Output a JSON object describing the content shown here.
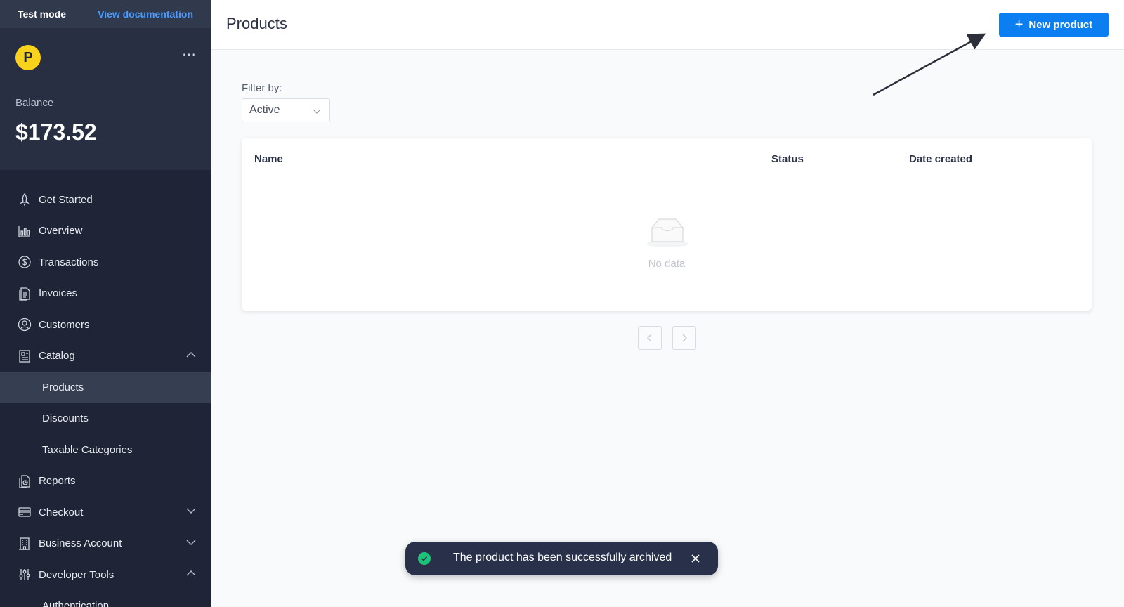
{
  "topbar": {
    "mode_label": "Test mode",
    "docs_link": "View documentation"
  },
  "account": {
    "logo_letter": "P",
    "more": "⋯",
    "balance_label": "Balance",
    "balance_value": "$173.52"
  },
  "sidebar": {
    "items": [
      {
        "label": "Get Started",
        "icon": "rocket-icon"
      },
      {
        "label": "Overview",
        "icon": "chart-icon"
      },
      {
        "label": "Transactions",
        "icon": "dollar-icon"
      },
      {
        "label": "Invoices",
        "icon": "invoice-icon"
      },
      {
        "label": "Customers",
        "icon": "user-icon"
      },
      {
        "label": "Catalog",
        "icon": "catalog-icon",
        "expanded": true
      },
      {
        "label": "Products",
        "sub": true,
        "active": true
      },
      {
        "label": "Discounts",
        "sub": true
      },
      {
        "label": "Taxable Categories",
        "sub": true
      },
      {
        "label": "Reports",
        "icon": "reports-icon"
      },
      {
        "label": "Checkout",
        "icon": "card-icon",
        "expanded": false
      },
      {
        "label": "Business Account",
        "icon": "building-icon",
        "expanded": false
      },
      {
        "label": "Developer Tools",
        "icon": "sliders-icon",
        "expanded": true
      },
      {
        "label": "Authentication",
        "sub": true
      }
    ]
  },
  "header": {
    "title": "Products",
    "new_button": "New product"
  },
  "filter": {
    "label": "Filter by:",
    "value": "Active"
  },
  "table": {
    "columns": [
      "Name",
      "Status",
      "Date created"
    ],
    "empty_text": "No data"
  },
  "toast": {
    "message": "The product has been successfully archived"
  },
  "colors": {
    "accent": "#0b7ff2",
    "sidebar_bg": "#1f2536",
    "success": "#1ec37a",
    "logo": "#f9d21b"
  }
}
